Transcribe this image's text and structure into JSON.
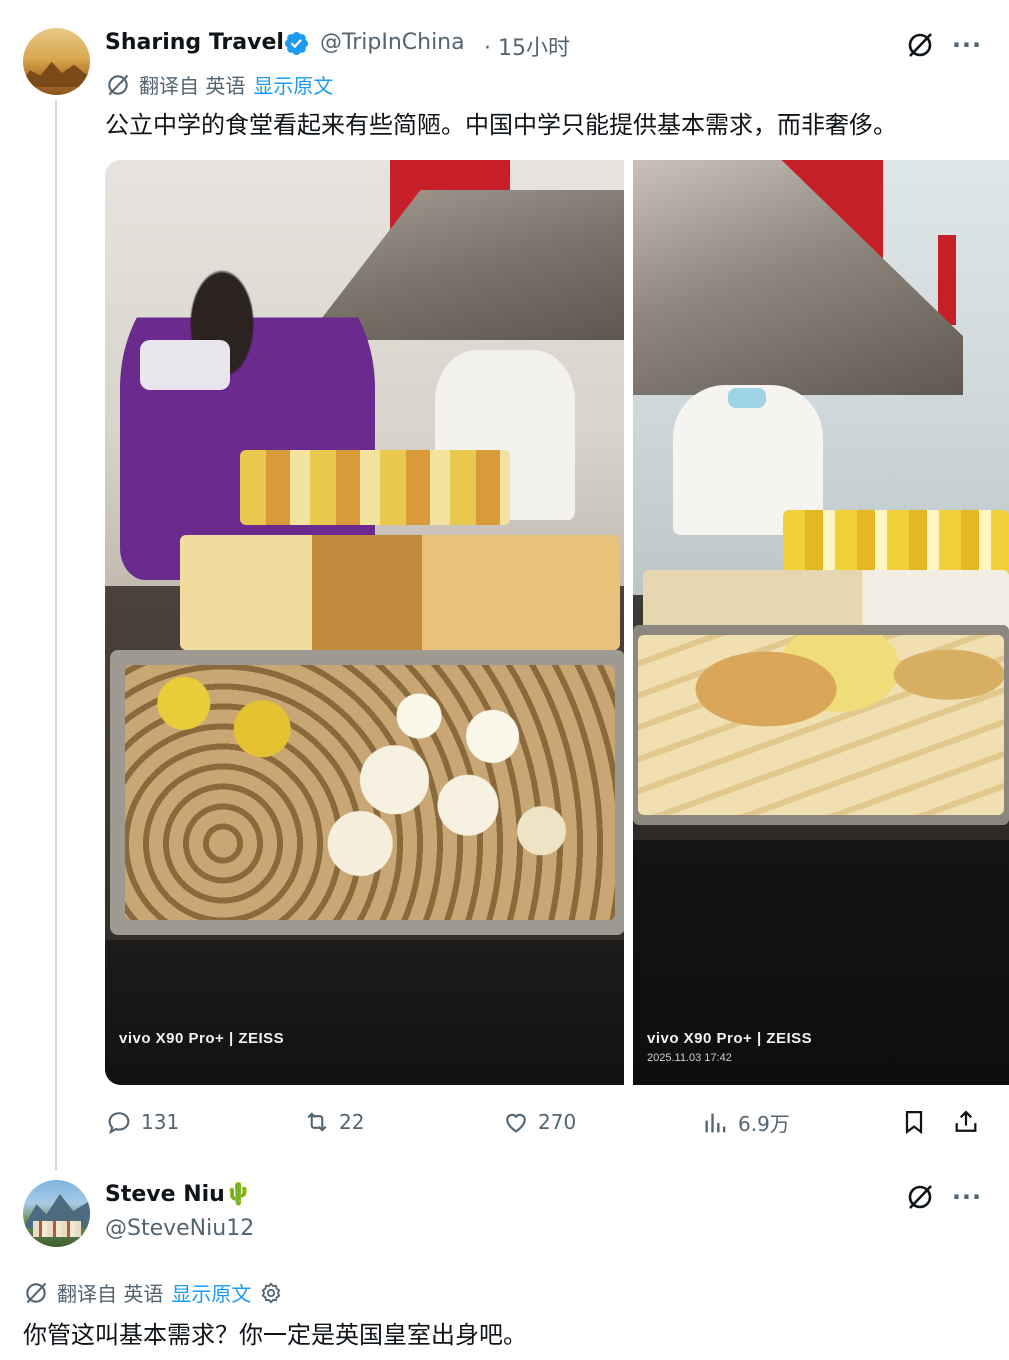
{
  "tweet": {
    "author_name": "Sharing Travel",
    "author_handle": "@TripInChina",
    "time": "· 15小时",
    "translate_label": "翻译自 英语",
    "show_original": "显示原文",
    "text": "公立中学的食堂看起来有些简陋。中国中学只能提供基本需求，而非奢侈。",
    "photos": [
      {
        "watermark_brand": "vivo X90 Pro+ | ZEISS",
        "watermark_date": ""
      },
      {
        "watermark_brand": "vivo X90 Pro+ | ZEISS",
        "watermark_date": "2025.11.03 17:42"
      }
    ],
    "actions": {
      "replies": "131",
      "retweets": "22",
      "likes": "270",
      "views": "6.9万"
    }
  },
  "reply": {
    "author_name": "Steve Niu🌵",
    "author_handle": "@SteveNiu12",
    "translate_label": "翻译自 英语",
    "show_original": "显示原文",
    "text": "你管这叫基本需求？你一定是英国皇室出身吧。"
  },
  "icons": {
    "verified": "verified-badge-icon",
    "grok": "grok-icon",
    "more": "more-icon",
    "reply": "reply-icon",
    "retweet": "retweet-icon",
    "like": "like-icon",
    "views": "views-icon",
    "bookmark": "bookmark-icon",
    "share": "share-icon",
    "translate": "translate-icon",
    "settings": "settings-icon"
  },
  "colors": {
    "link": "#1d9bf0",
    "muted": "#536471",
    "text": "#0f1419",
    "verified": "#1d9bf0"
  }
}
